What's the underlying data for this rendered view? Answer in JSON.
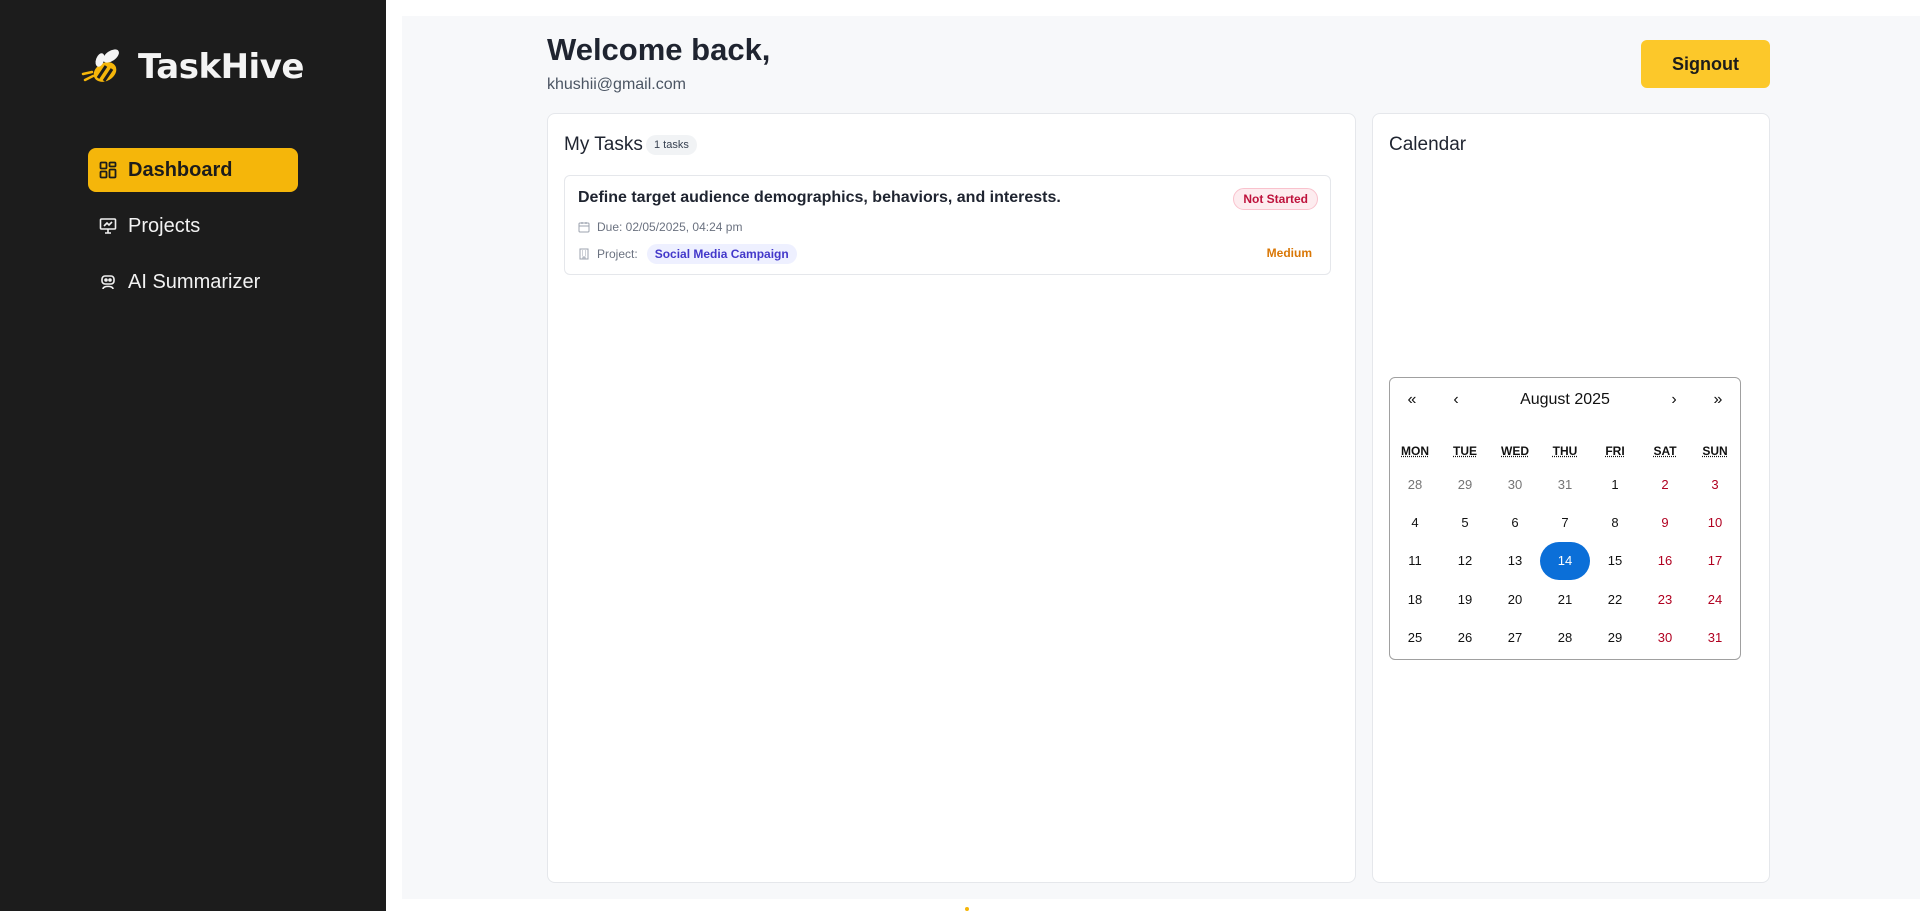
{
  "app": {
    "name": "TaskHive"
  },
  "sidebar": {
    "items": [
      {
        "label": "Dashboard",
        "icon": "dashboard-grid-icon",
        "active": true
      },
      {
        "label": "Projects",
        "icon": "presentation-board-icon",
        "active": false
      },
      {
        "label": "AI Summarizer",
        "icon": "robot-icon",
        "active": false
      }
    ]
  },
  "header": {
    "welcome": "Welcome back,",
    "email": "khushii@gmail.com",
    "signout_label": "Signout"
  },
  "tasks": {
    "title": "My Tasks",
    "count_label": "1 tasks",
    "items": [
      {
        "title": "Define target audience demographics, behaviors, and interests.",
        "status": "Not Started",
        "due": "Due: 02/05/2025, 04:24 pm",
        "project_label": "Project:",
        "project": "Social Media Campaign",
        "priority": "Medium"
      }
    ]
  },
  "calendar": {
    "title": "Calendar",
    "nav": {
      "prev2": "«",
      "prev": "‹",
      "next": "›",
      "next2": "»"
    },
    "month_label": "August 2025",
    "weekdays": [
      "MON",
      "TUE",
      "WED",
      "THU",
      "FRI",
      "SAT",
      "SUN"
    ],
    "days": [
      "28",
      "29",
      "30",
      "31",
      "1",
      "2",
      "3",
      "4",
      "5",
      "6",
      "7",
      "8",
      "9",
      "10",
      "11",
      "12",
      "13",
      "14",
      "15",
      "16",
      "17",
      "18",
      "19",
      "20",
      "21",
      "22",
      "23",
      "24",
      "25",
      "26",
      "27",
      "28",
      "29",
      "30",
      "31"
    ],
    "selected_day": "14",
    "colors": {
      "selected": "#0b6fd8",
      "weekend": "#b00020",
      "neighbor": "#757575"
    }
  },
  "colors": {
    "accent": "#f5b60a",
    "signout": "#fcc82a",
    "sidebar_bg": "#1c1c1c",
    "status_not_started": "#be123c",
    "priority_medium": "#d97706",
    "project_chip": "#4338ca"
  }
}
